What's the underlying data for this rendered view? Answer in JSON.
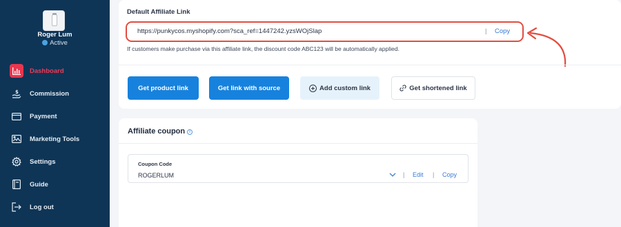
{
  "user": {
    "name": "Roger Lum",
    "status": "Active"
  },
  "sidebar": {
    "items": [
      {
        "label": "Dashboard",
        "icon": "bar-chart-icon",
        "active": true
      },
      {
        "label": "Commission",
        "icon": "commission-icon"
      },
      {
        "label": "Payment",
        "icon": "card-icon"
      },
      {
        "label": "Marketing Tools",
        "icon": "image-icon"
      },
      {
        "label": "Settings",
        "icon": "gear-icon"
      },
      {
        "label": "Guide",
        "icon": "book-icon"
      },
      {
        "label": "Log out",
        "icon": "logout-icon"
      }
    ]
  },
  "affiliate_link": {
    "label": "Default Affiliate Link",
    "url": "https://punkycos.myshopify.com?sca_ref=1447242.yzsWOjSlap",
    "separator": "|",
    "copy_label": "Copy",
    "note": "If customers make purchase via this affiliate link, the discount code ABC123 will be automatically applied."
  },
  "actions": {
    "product_link": "Get product link",
    "link_with_source": "Get link with source",
    "custom_link": "Add custom link",
    "shortened_link": "Get shortened link"
  },
  "coupon": {
    "title": "Affiliate coupon",
    "field_label": "Coupon Code",
    "value": "ROGERLUM",
    "separator": "|",
    "edit_label": "Edit",
    "copy_label": "Copy"
  },
  "colors": {
    "sidebar_bg": "#0e3556",
    "accent_red": "#e8364f",
    "primary_blue": "#1782dd",
    "highlight": "#e24d3f"
  }
}
